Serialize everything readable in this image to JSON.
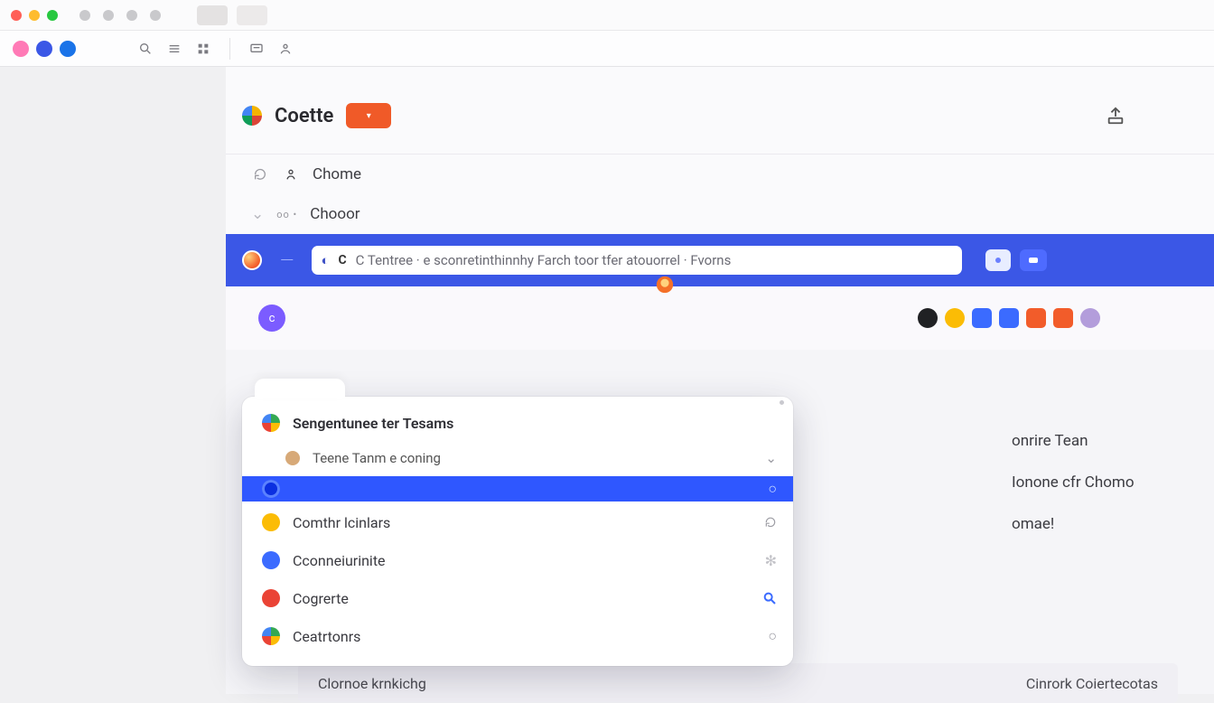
{
  "header": {
    "title": "Coette",
    "orange_btn": "•"
  },
  "breadcrumb": {
    "line1": "Chome",
    "line2": "Chooor",
    "line2_prefix": "oo •"
  },
  "omnibar": {
    "value": "C Tentree · e sconretinthinnhy Farch toor tfer atouorrel · Fvorns"
  },
  "dropdown": {
    "items": [
      {
        "label": "Sengentunee ter Tesams",
        "icon": "#34a853|#fbbc05|#ea4335|#4285f4",
        "kind": "header"
      },
      {
        "label": "Teene Tanm e coning",
        "icon": "#d7a978",
        "kind": "sub",
        "tail": "⌄"
      },
      {
        "label": "",
        "icon": "#2f57ff",
        "kind": "sel",
        "tail": "○"
      },
      {
        "label": "Comthr lcinlars",
        "icon": "#fbbc05",
        "kind": "item",
        "tail": "↻"
      },
      {
        "label": "Cconneiurinite",
        "icon": "#3b6bff",
        "kind": "item",
        "tail": ""
      },
      {
        "label": "Cogrerte",
        "icon": "#ea4335",
        "kind": "item",
        "tail": "🔍"
      },
      {
        "label": "Ceatrtonrs",
        "icon": "#34a853|#fbbc05|#ea4335|#4285f4",
        "kind": "item",
        "tail": "○"
      }
    ]
  },
  "right_col": {
    "r1": "onrire Tean",
    "r2": "Ionone cfr Chomo",
    "r3": "omae!"
  },
  "bottom": {
    "left": "Clornoe krnkichg",
    "right": "Cinrork Coiertecotas"
  },
  "chips": {
    "colors": [
      "#202124",
      "#fbbc05",
      "#3b6bff",
      "#3b6bff",
      "#f25c2a",
      "#f25c2a",
      "#b39ddb"
    ]
  },
  "toolbar_avatars": [
    "#ff7ab6",
    "#3b57e6",
    "#1a73e8"
  ]
}
